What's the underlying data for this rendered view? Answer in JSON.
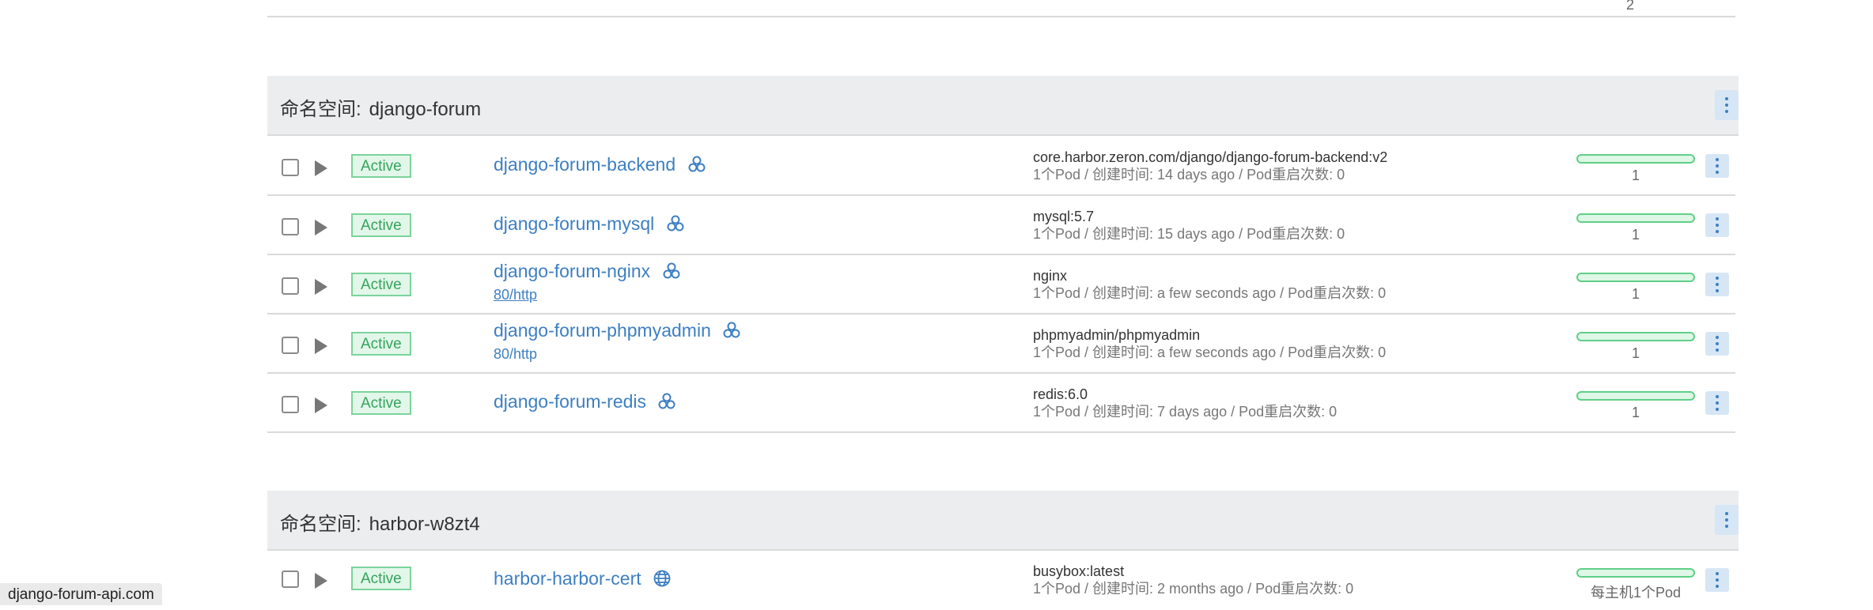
{
  "previous_row_partial": {
    "count_text": "2"
  },
  "namespaces": [
    {
      "label": "命名空间:",
      "name": "django-forum",
      "workloads": [
        {
          "status": "Active",
          "name": "django-forum-backend",
          "icon": "deployment-icon",
          "endpoint": "",
          "image": "core.harbor.zeron.com/django/django-forum-backend:v2",
          "meta": "1个Pod / 创建时间: 14 days ago / Pod重启次数: 0",
          "scale": "1"
        },
        {
          "status": "Active",
          "name": "django-forum-mysql",
          "icon": "deployment-icon",
          "endpoint": "",
          "image": "mysql:5.7",
          "meta": "1个Pod / 创建时间: 15 days ago / Pod重启次数: 0",
          "scale": "1"
        },
        {
          "status": "Active",
          "name": "django-forum-nginx",
          "icon": "deployment-icon",
          "endpoint": "80/http",
          "image": "nginx",
          "meta": "1个Pod / 创建时间: a few seconds ago / Pod重启次数: 0",
          "scale": "1"
        },
        {
          "status": "Active",
          "name": "django-forum-phpmyadmin",
          "icon": "deployment-icon",
          "endpoint": "80/http",
          "image": "phpmyadmin/phpmyadmin",
          "meta": "1个Pod / 创建时间: a few seconds ago / Pod重启次数: 0",
          "scale": "1"
        },
        {
          "status": "Active",
          "name": "django-forum-redis",
          "icon": "deployment-icon",
          "endpoint": "",
          "image": "redis:6.0",
          "meta": "1个Pod / 创建时间: 7 days ago / Pod重启次数: 0",
          "scale": "1"
        }
      ]
    },
    {
      "label": "命名空间:",
      "name": "harbor-w8zt4",
      "workloads": [
        {
          "status": "Active",
          "name": "harbor-harbor-cert",
          "icon": "globe-icon",
          "endpoint": "",
          "image": "busybox:latest",
          "meta": "1个Pod / 创建时间: 2 months ago / Pod重启次数: 0",
          "scale": "每主机1个Pod"
        }
      ]
    }
  ],
  "status_bar": {
    "url": "django-forum-api.com"
  },
  "colors": {
    "link": "#3d7fc2",
    "active_green": "#34a35c",
    "header_bg": "#ebedef",
    "menu_btn_bg": "#d7e6f5"
  }
}
